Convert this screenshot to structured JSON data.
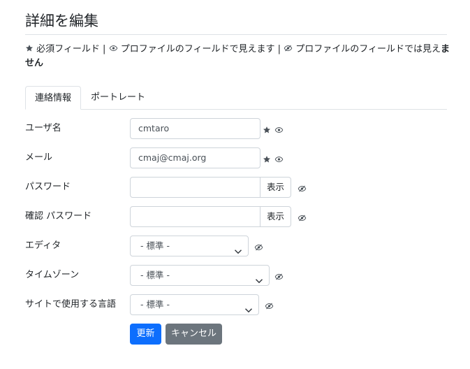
{
  "page": {
    "title": "詳細を編集"
  },
  "legend": {
    "required": "必須フィールド",
    "separator1": "|",
    "visible": "プロファイルのフィールドで見えます",
    "separator2": "|",
    "hidden_prefix": "プロファイルのフィールドでは見え",
    "hidden_bold": "ません"
  },
  "tabs": [
    {
      "label": "連絡情報",
      "active": true
    },
    {
      "label": "ポートレート",
      "active": false
    }
  ],
  "form": {
    "username": {
      "label": "ユーザ名",
      "value": "cmtaro"
    },
    "email": {
      "label": "メール",
      "value": "cmaj@cmaj.org"
    },
    "password": {
      "label": "パスワード",
      "value": "",
      "show_label": "表示"
    },
    "password_confirm": {
      "label": "確認 パスワード",
      "value": "",
      "show_label": "表示"
    },
    "editor": {
      "label": "エディタ",
      "selected": "- 標準 -"
    },
    "timezone": {
      "label": "タイムゾーン",
      "selected": "- 標準 -"
    },
    "site_language": {
      "label": "サイトで使用する言語",
      "selected": "- 標準 -"
    }
  },
  "buttons": {
    "save": "更新",
    "cancel": "キャンセル"
  },
  "colors": {
    "primary": "#0d6efd",
    "secondary": "#6c757d",
    "icon": "#495057",
    "border": "#ced4da"
  },
  "icons": {
    "required": "star-icon",
    "visible": "eye-icon",
    "hidden": "eye-slash-icon",
    "dropdown": "chevron-down-icon"
  }
}
